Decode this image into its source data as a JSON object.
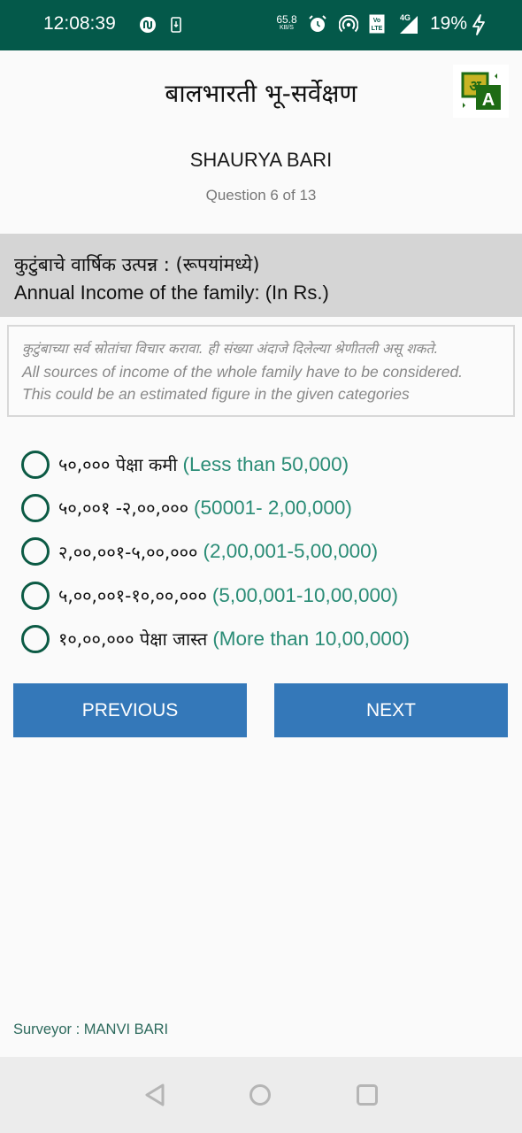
{
  "status_bar": {
    "time": "12:08:39",
    "left_icons": [
      "sync-app-icon",
      "download-phone-icon"
    ],
    "net_speed_value": "65.8",
    "net_speed_unit": "KB/S",
    "right_icons": [
      "alarm-icon",
      "hotspot-icon",
      "volte-icon",
      "signal-4g-icon"
    ],
    "network_type": "4G",
    "volte_label": "Vo LTE",
    "battery": "19%",
    "charging": true
  },
  "header": {
    "app_title": "बालभारती भू-सर्वेक्षण",
    "language_button_icon": "translate-icon",
    "language_icon_glyphs": [
      "अ",
      "A"
    ]
  },
  "student": {
    "name": "SHAURYA BARI"
  },
  "progress": {
    "label": "Question 6 of 13",
    "current": 6,
    "total": 13
  },
  "question": {
    "title_mr": "कुटुंबाचे वार्षिक उत्पन्न : (रूपयांमध्ये)",
    "title_en": "Annual Income of the family: (In Rs.)"
  },
  "hint": {
    "line_mr": "कुटुंबाच्या सर्व स्रोतांचा विचार करावा. ही संख्या अंदाजे दिलेल्या श्रेणीतली असू शकते.",
    "line_en_1": "All sources of income of the whole family have to be considered.",
    "line_en_2": "This could be an estimated figure in the given categories"
  },
  "options": [
    {
      "label_mr": "५०,००० पेक्षा कमी",
      "label_en": "(Less than 50,000)",
      "selected": false
    },
    {
      "label_mr": "५०,००१ -२,००,०००",
      "label_en": "(50001- 2,00,000)",
      "selected": false
    },
    {
      "label_mr": "२,००,००१-५,००,०००",
      "label_en": "(2,00,001-5,00,000)",
      "selected": false
    },
    {
      "label_mr": "५,००,००१-१०,००,०००",
      "label_en": "(5,00,001-10,00,000)",
      "selected": false
    },
    {
      "label_mr": "१०,००,००० पेक्षा जास्त",
      "label_en": "(More than 10,00,000)",
      "selected": false
    }
  ],
  "buttons": {
    "previous_label": "PREVIOUS",
    "next_label": "NEXT"
  },
  "footer": {
    "surveyor": "Surveyor : MANVI BARI"
  },
  "nav_bar": {
    "back_icon": "back-triangle-icon",
    "home_icon": "home-circle-icon",
    "recents_icon": "recents-square-icon"
  },
  "colors": {
    "status_bar": "#04594a",
    "radio": "#0b5a44",
    "option_english": "#2a8c76",
    "button": "#3478b9",
    "question_bg": "#d5d5d5",
    "surveyor_text": "#2d6a5d"
  }
}
